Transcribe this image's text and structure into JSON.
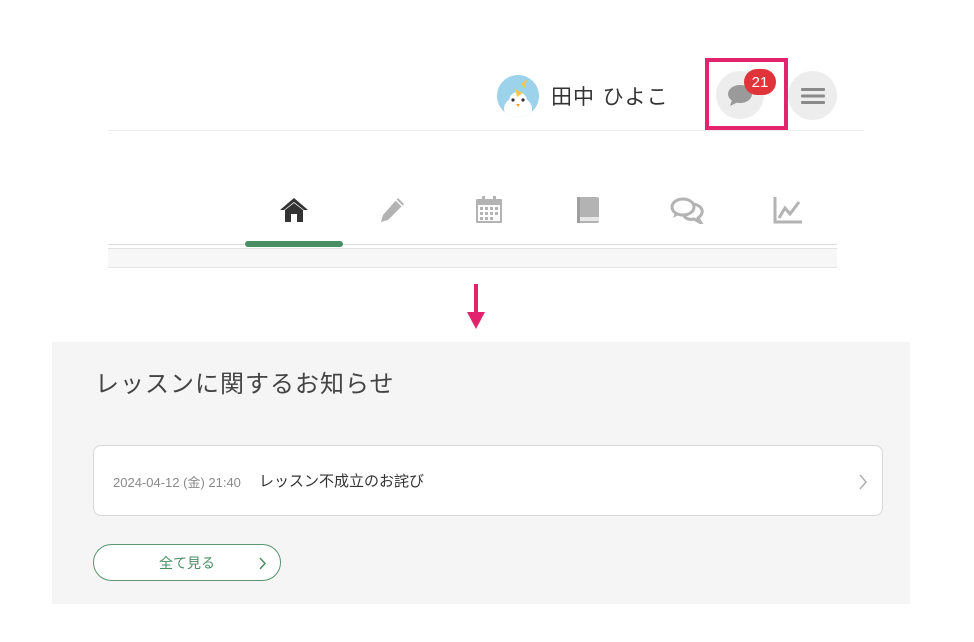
{
  "header": {
    "user_name": "田中 ひよこ",
    "message_count": "21",
    "avatar_icon": "chick-avatar",
    "message_icon": "speech-bubble-icon",
    "menu_icon": "hamburger-menu-icon"
  },
  "tabs": [
    {
      "icon": "home-icon",
      "active": true
    },
    {
      "icon": "pencil-icon",
      "active": false
    },
    {
      "icon": "calendar-icon",
      "active": false
    },
    {
      "icon": "book-icon",
      "active": false
    },
    {
      "icon": "chat-bubbles-icon",
      "active": false
    },
    {
      "icon": "line-chart-icon",
      "active": false
    }
  ],
  "notices": {
    "heading": "レッスンに関するお知らせ",
    "items": [
      {
        "date": "2024-04-12 (金) 21:40",
        "title": "レッスン不成立のお詫び"
      }
    ],
    "view_all_label": "全て見る"
  },
  "colors": {
    "accent_green": "#4a8f63",
    "highlight_pink": "#e2246f",
    "badge_red": "#e0343a",
    "icon_gray": "#b3b3b3",
    "active_icon": "#333333"
  }
}
